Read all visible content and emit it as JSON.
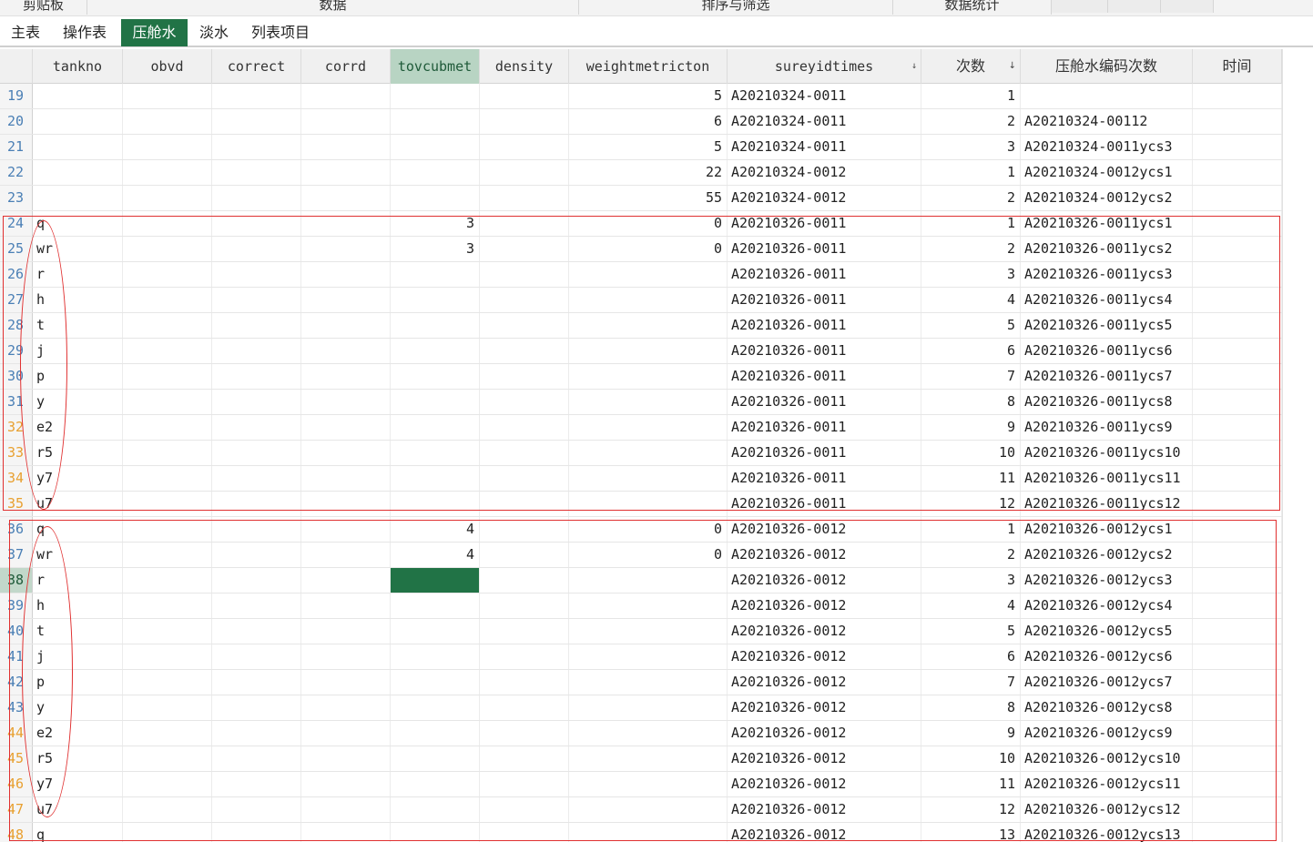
{
  "ribbon": {
    "groups": [
      "剪贴板",
      "数据",
      "排序与筛选",
      "数据统计"
    ]
  },
  "tabs": [
    {
      "label": "主表",
      "active": false
    },
    {
      "label": "操作表",
      "active": false
    },
    {
      "label": "压舱水",
      "active": true
    },
    {
      "label": "淡水",
      "active": false
    },
    {
      "label": "列表项目",
      "active": false
    }
  ],
  "grid": {
    "columns": [
      {
        "key": "tankno",
        "label": "tankno",
        "selected": false,
        "sorted": false
      },
      {
        "key": "obvd",
        "label": "obvd",
        "selected": false,
        "sorted": false
      },
      {
        "key": "correct",
        "label": "correct",
        "selected": false,
        "sorted": false
      },
      {
        "key": "corrd",
        "label": "corrd",
        "selected": false,
        "sorted": false
      },
      {
        "key": "tovcubmet",
        "label": "tovcubmet",
        "selected": true,
        "sorted": false
      },
      {
        "key": "density",
        "label": "density",
        "selected": false,
        "sorted": false
      },
      {
        "key": "weightmetricton",
        "label": "weightmetricton",
        "selected": false,
        "sorted": false
      },
      {
        "key": "sureyidtimes",
        "label": "sureyidtimes",
        "selected": false,
        "sorted": true
      },
      {
        "key": "count",
        "label": "次数",
        "selected": false,
        "sorted": true
      },
      {
        "key": "code",
        "label": "压舱水编码次数",
        "selected": false,
        "sorted": false
      },
      {
        "key": "time",
        "label": "时间",
        "selected": false,
        "sorted": false
      }
    ],
    "sort_arrow": "↓",
    "current_row": "38",
    "rows": [
      {
        "n": "19",
        "tankno": "",
        "tov": "",
        "weight": "5",
        "survey": "A20210324-0011",
        "count": "1",
        "code": ""
      },
      {
        "n": "20",
        "tankno": "",
        "tov": "",
        "weight": "6",
        "survey": "A20210324-0011",
        "count": "2",
        "code": "A20210324-00112"
      },
      {
        "n": "21",
        "tankno": "",
        "tov": "",
        "weight": "5",
        "survey": "A20210324-0011",
        "count": "3",
        "code": "A20210324-0011ycs3"
      },
      {
        "n": "22",
        "tankno": "",
        "tov": "",
        "weight": "22",
        "survey": "A20210324-0012",
        "count": "1",
        "code": "A20210324-0012ycs1"
      },
      {
        "n": "23",
        "tankno": "",
        "tov": "",
        "weight": "55",
        "survey": "A20210324-0012",
        "count": "2",
        "code": "A20210324-0012ycs2"
      },
      {
        "n": "24",
        "tankno": "q",
        "tov": "3",
        "weight": "0",
        "survey": "A20210326-0011",
        "count": "1",
        "code": "A20210326-0011ycs1"
      },
      {
        "n": "25",
        "tankno": "wr",
        "tov": "3",
        "weight": "0",
        "survey": "A20210326-0011",
        "count": "2",
        "code": "A20210326-0011ycs2"
      },
      {
        "n": "26",
        "tankno": "r",
        "tov": "",
        "weight": "",
        "survey": "A20210326-0011",
        "count": "3",
        "code": "A20210326-0011ycs3"
      },
      {
        "n": "27",
        "tankno": "h",
        "tov": "",
        "weight": "",
        "survey": "A20210326-0011",
        "count": "4",
        "code": "A20210326-0011ycs4"
      },
      {
        "n": "28",
        "tankno": "t",
        "tov": "",
        "weight": "",
        "survey": "A20210326-0011",
        "count": "5",
        "code": "A20210326-0011ycs5"
      },
      {
        "n": "29",
        "tankno": "j",
        "tov": "",
        "weight": "",
        "survey": "A20210326-0011",
        "count": "6",
        "code": "A20210326-0011ycs6"
      },
      {
        "n": "30",
        "tankno": "p",
        "tov": "",
        "weight": "",
        "survey": "A20210326-0011",
        "count": "7",
        "code": "A20210326-0011ycs7"
      },
      {
        "n": "31",
        "tankno": "y",
        "tov": "",
        "weight": "",
        "survey": "A20210326-0011",
        "count": "8",
        "code": "A20210326-0011ycs8"
      },
      {
        "n": "32",
        "tankno": "e2",
        "tov": "",
        "weight": "",
        "survey": "A20210326-0011",
        "count": "9",
        "code": "A20210326-0011ycs9"
      },
      {
        "n": "33",
        "tankno": "r5",
        "tov": "",
        "weight": "",
        "survey": "A20210326-0011",
        "count": "10",
        "code": "A20210326-0011ycs10"
      },
      {
        "n": "34",
        "tankno": "y7",
        "tov": "",
        "weight": "",
        "survey": "A20210326-0011",
        "count": "11",
        "code": "A20210326-0011ycs11"
      },
      {
        "n": "35",
        "tankno": "u7",
        "tov": "",
        "weight": "",
        "survey": "A20210326-0011",
        "count": "12",
        "code": "A20210326-0011ycs12"
      },
      {
        "n": "36",
        "tankno": "q",
        "tov": "4",
        "weight": "0",
        "survey": "A20210326-0012",
        "count": "1",
        "code": "A20210326-0012ycs1"
      },
      {
        "n": "37",
        "tankno": "wr",
        "tov": "4",
        "weight": "0",
        "survey": "A20210326-0012",
        "count": "2",
        "code": "A20210326-0012ycs2"
      },
      {
        "n": "38",
        "tankno": "r",
        "tov": "",
        "weight": "",
        "survey": "A20210326-0012",
        "count": "3",
        "code": "A20210326-0012ycs3"
      },
      {
        "n": "39",
        "tankno": "h",
        "tov": "",
        "weight": "",
        "survey": "A20210326-0012",
        "count": "4",
        "code": "A20210326-0012ycs4"
      },
      {
        "n": "40",
        "tankno": "t",
        "tov": "",
        "weight": "",
        "survey": "A20210326-0012",
        "count": "5",
        "code": "A20210326-0012ycs5"
      },
      {
        "n": "41",
        "tankno": "j",
        "tov": "",
        "weight": "",
        "survey": "A20210326-0012",
        "count": "6",
        "code": "A20210326-0012ycs6"
      },
      {
        "n": "42",
        "tankno": "p",
        "tov": "",
        "weight": "",
        "survey": "A20210326-0012",
        "count": "7",
        "code": "A20210326-0012ycs7"
      },
      {
        "n": "43",
        "tankno": "y",
        "tov": "",
        "weight": "",
        "survey": "A20210326-0012",
        "count": "8",
        "code": "A20210326-0012ycs8"
      },
      {
        "n": "44",
        "tankno": "e2",
        "tov": "",
        "weight": "",
        "survey": "A20210326-0012",
        "count": "9",
        "code": "A20210326-0012ycs9"
      },
      {
        "n": "45",
        "tankno": "r5",
        "tov": "",
        "weight": "",
        "survey": "A20210326-0012",
        "count": "10",
        "code": "A20210326-0012ycs10"
      },
      {
        "n": "46",
        "tankno": "y7",
        "tov": "",
        "weight": "",
        "survey": "A20210326-0012",
        "count": "11",
        "code": "A20210326-0012ycs11"
      },
      {
        "n": "47",
        "tankno": "u7",
        "tov": "",
        "weight": "",
        "survey": "A20210326-0012",
        "count": "12",
        "code": "A20210326-0012ycs12"
      },
      {
        "n": "48",
        "tankno": "q",
        "tov": "",
        "weight": "",
        "survey": "A20210326-0012",
        "count": "13",
        "code": "A20210326-0012ycs13"
      }
    ]
  },
  "colors": {
    "accent": "#217346",
    "rownum_blue": "#4a7fb5",
    "rownum_orange": "#e8a030",
    "annotation_red": "#e03030"
  }
}
